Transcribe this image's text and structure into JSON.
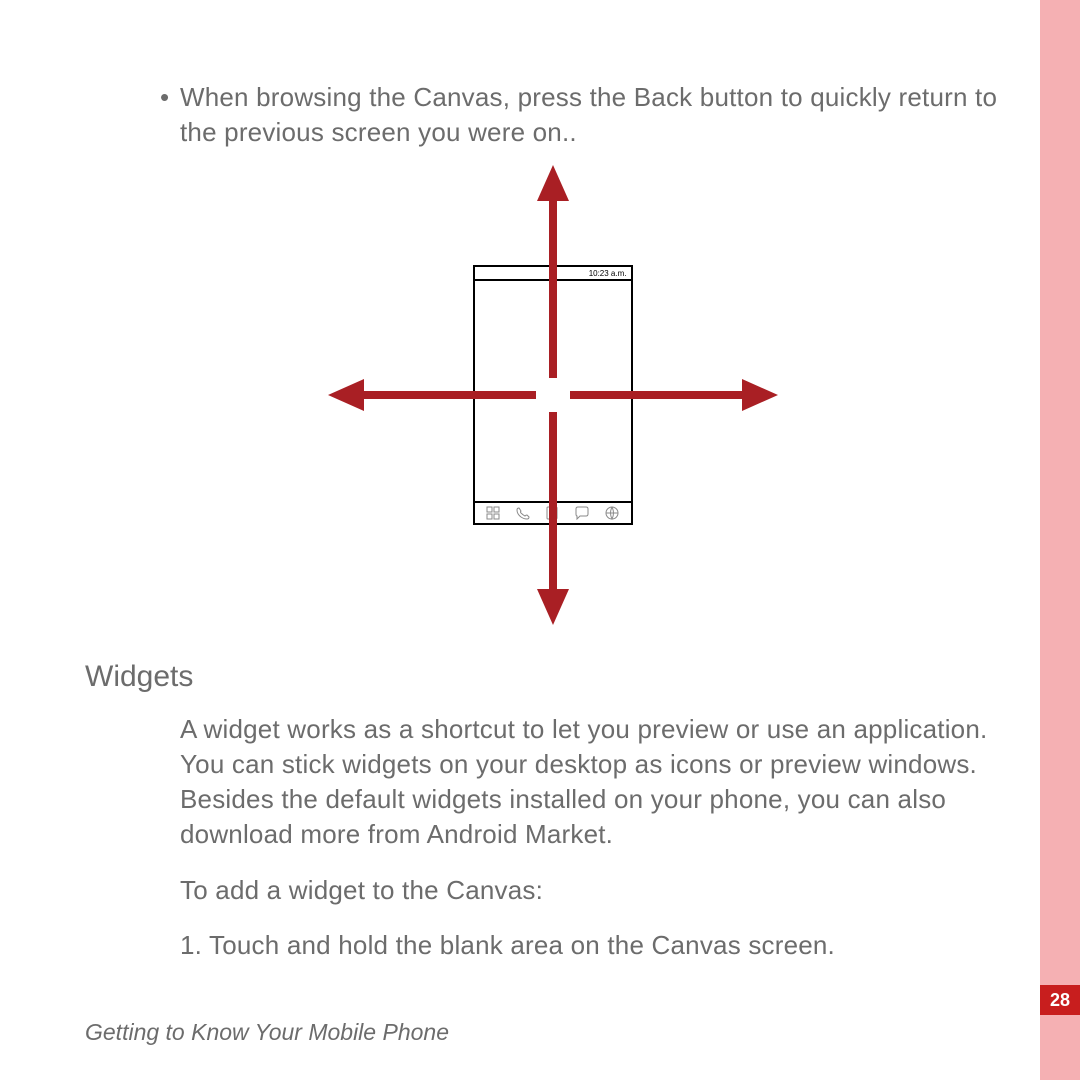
{
  "bullet_text": "When browsing the Canvas, press the Back button to quickly return to the previous screen you were on..",
  "diagram": {
    "status_time": "10:23 a.m.",
    "arrow_color": "#a91f24"
  },
  "heading": "Widgets",
  "widgets_desc": "A widget works as a shortcut to let you preview or use an application. You can stick widgets on your desktop as icons or preview windows. Besides the default widgets installed on your phone, you can also download more from Android Market.",
  "add_widget_intro": "To add a widget to the Canvas:",
  "step1": "1. Touch and hold the blank area on the Canvas screen.",
  "footer": "Getting to Know Your Mobile Phone",
  "page_number": "28"
}
